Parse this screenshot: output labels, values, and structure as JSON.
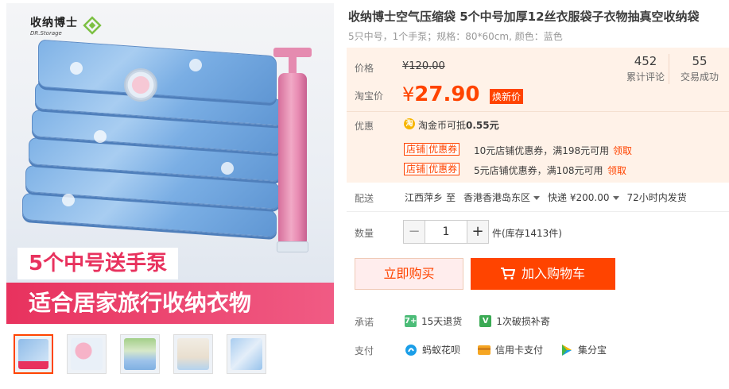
{
  "product": {
    "title": "收纳博士空气压缩袋 5个中号加厚12丝衣服袋子衣物抽真空收纳袋",
    "subtitle": "5只中号，1个手泵；规格：80*60cm, 颜色：蓝色"
  },
  "gallery": {
    "logo_cn": "收纳博士",
    "logo_en": "DR.Storage",
    "banner_line1": "5个中号送手泵",
    "banner_line2": "适合居家旅行收纳衣物",
    "thumbnails": [
      "thumb-1",
      "thumb-2",
      "thumb-3",
      "thumb-4",
      "thumb-5"
    ]
  },
  "price": {
    "label": "价格",
    "original": "¥120.00",
    "taobao_label": "淘宝价",
    "currency": "¥",
    "current": "27.90",
    "badge": "焕新价"
  },
  "stats": [
    {
      "value": "452",
      "label": "累计评论"
    },
    {
      "value": "55",
      "label": "交易成功"
    }
  ],
  "promo": {
    "label": "优惠",
    "coin_icon": "淘",
    "coin_text_prefix": "淘金币可抵",
    "coin_amount": "0.55元",
    "coupons": [
      {
        "tag_left": "店铺",
        "tag_right": "优惠券",
        "desc": "10元店铺优惠券，满198元可用",
        "link": "领取"
      },
      {
        "tag_left": "店铺",
        "tag_right": "优惠券",
        "desc": "5元店铺优惠券，满108元可用",
        "link": "领取"
      }
    ]
  },
  "shipping": {
    "label": "配送",
    "from": "江西萍乡",
    "to_word": "至",
    "to": "香港香港岛东区",
    "method": "快递 ¥200.00",
    "dispatch": "72小时内发货"
  },
  "quantity": {
    "label": "数量",
    "minus": "−",
    "value": "1",
    "plus": "+",
    "stock": "件(库存1413件)"
  },
  "actions": {
    "buy_now": "立即购买",
    "add_to_cart": "加入购物车"
  },
  "promise": {
    "label": "承诺",
    "items": [
      {
        "icon": "7+",
        "text": "15天退货"
      },
      {
        "icon": "V",
        "text": "1次破损补寄"
      }
    ]
  },
  "payment": {
    "label": "支付",
    "methods": [
      "蚂蚁花呗",
      "信用卡支付",
      "集分宝"
    ]
  },
  "colors": {
    "accent": "#ff4400",
    "price_bg": "#fff2e8",
    "banner": "#e8325e"
  }
}
